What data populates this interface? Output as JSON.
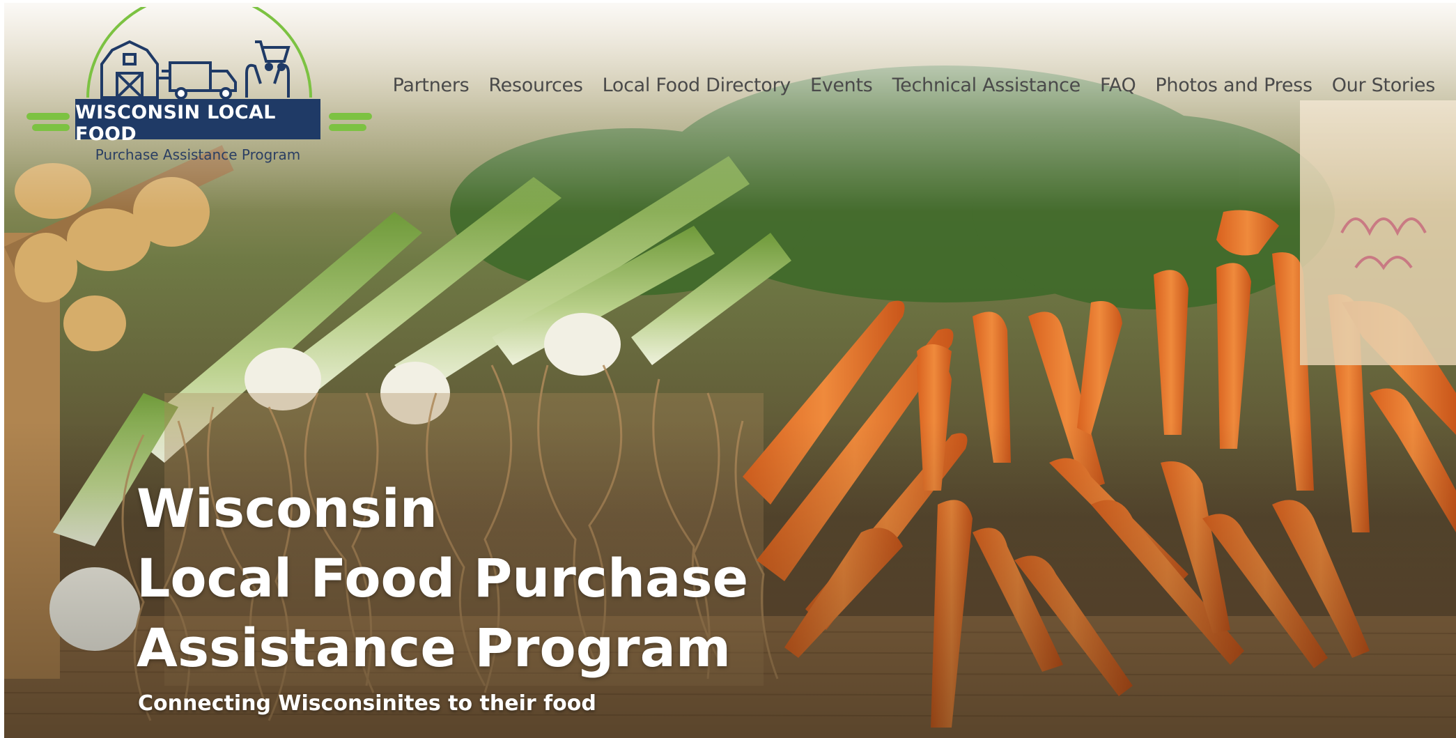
{
  "logo": {
    "name": "WISCONSIN LOCAL FOOD",
    "tagline": "Purchase Assistance Program"
  },
  "nav": {
    "items": [
      {
        "label": "Partners"
      },
      {
        "label": "Resources"
      },
      {
        "label": "Local Food Directory"
      },
      {
        "label": "Events"
      },
      {
        "label": "Technical Assistance"
      },
      {
        "label": "FAQ"
      },
      {
        "label": "Photos and Press"
      },
      {
        "label": "Our Stories"
      }
    ]
  },
  "hero": {
    "headline_lines": [
      "Wisconsin",
      "Local Food Purchase",
      "Assistance Program"
    ],
    "subtitle": "Connecting Wisconsinites to their food"
  },
  "colors": {
    "logo_navy": "#1f3a66",
    "logo_green": "#7cc242",
    "nav_text": "#4a4a4a",
    "hero_text": "#ffffff"
  },
  "icons": [
    "barn-icon",
    "delivery-truck-icon",
    "hands-cart-icon"
  ]
}
